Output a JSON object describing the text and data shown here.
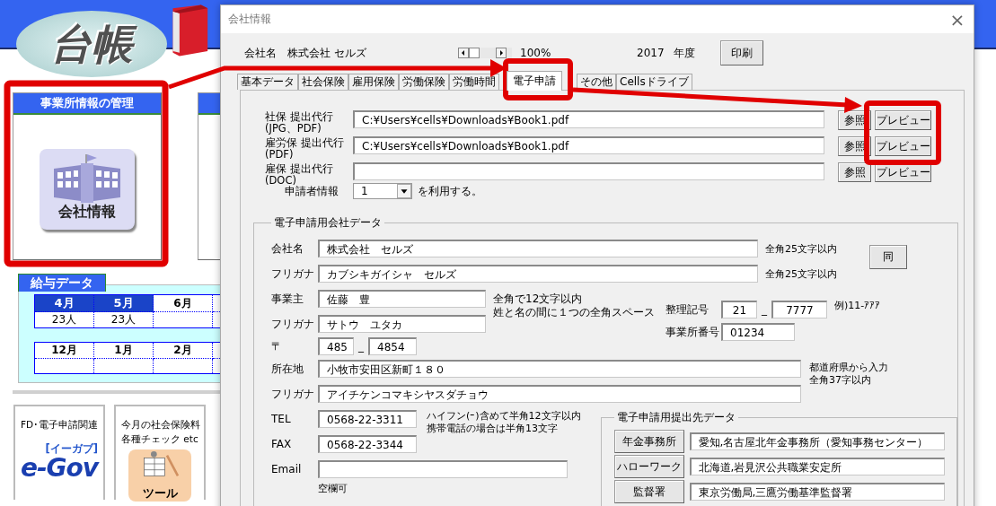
{
  "app": {
    "logo": "台帳",
    "panel": {
      "title": "事業所情報の管理",
      "button": "会社情報"
    },
    "payroll": {
      "title": "給与データ",
      "tables": [
        {
          "months": [
            {
              "label": "4月",
              "highlighted": true,
              "count": "23人"
            },
            {
              "label": "5月",
              "highlighted": true,
              "count": "23人"
            },
            {
              "label": "6月",
              "highlighted": false
            }
          ]
        },
        {
          "months": [
            {
              "label": "12月",
              "highlighted": false
            },
            {
              "label": "1月",
              "highlighted": false
            },
            {
              "label": "2月",
              "highlighted": false
            }
          ]
        }
      ]
    },
    "shortcuts": [
      {
        "kind": "egov",
        "lines": [
          "FD･電子申請関連"
        ],
        "logo": "e-Gov",
        "logo_caption": "[イーガブ]"
      },
      {
        "kind": "tool",
        "lines": [
          "今月の社会保険料",
          "各種チェック etc"
        ],
        "icon_label": "ツール"
      }
    ]
  },
  "dialog": {
    "title": "会社情報",
    "close": "×",
    "company_label": "会社名",
    "company_name": "株式会社 セルズ",
    "zoom": "100%",
    "year": "2017",
    "year_unit": "年度",
    "print_button": "印刷",
    "tabs": [
      {
        "label": "基本データ",
        "selected": false
      },
      {
        "label": "社会保険",
        "selected": false
      },
      {
        "label": "雇用保険",
        "selected": false
      },
      {
        "label": "労働保険",
        "selected": false
      },
      {
        "label": "労働時間",
        "selected": false
      },
      {
        "label": "電子申請",
        "selected": true
      },
      {
        "label": "その他",
        "selected": false
      },
      {
        "label": "Cellsドライブ",
        "selected": false
      }
    ],
    "file_rows": [
      {
        "label": [
          "社保 提出代行",
          "(JPG、PDF)"
        ],
        "value": "C:¥Users¥cells¥Downloads¥Book1.pdf",
        "browse": "参照",
        "preview": "プレビュー"
      },
      {
        "label": [
          "雇労保 提出代行",
          "(PDF)"
        ],
        "value": "C:¥Users¥cells¥Downloads¥Book1.pdf",
        "browse": "参照",
        "preview": "プレビュー"
      },
      {
        "label": [
          "雇保 提出代行",
          "(DOC)"
        ],
        "browse": "参照",
        "preview": "プレビュー"
      }
    ],
    "applicant": {
      "label": "申請者情報",
      "value": "1",
      "suffix": "を利用する。"
    },
    "company_data": {
      "title": "電子申請用会社データ",
      "same_button": "同",
      "name": {
        "label": "会社名",
        "value": "株式会社　セルズ",
        "hint": "全角25文字以内"
      },
      "name_kana": {
        "label": "フリガナ",
        "value": "カブシキガイシャ　セルズ",
        "hint": "全角25文字以内"
      },
      "owner": {
        "label": "事業主",
        "value": "佐藤　豊"
      },
      "owner_kana": {
        "label": "フリガナ",
        "value": "サトウ　ユタカ"
      },
      "owner_hint": [
        "全角で12文字以内",
        "姓と名の間に１つの全角スペース"
      ],
      "postal": {
        "label": "〒",
        "first": "485",
        "separator": "_",
        "second": "4854"
      },
      "reference": {
        "label": "整理記号",
        "first": "21",
        "separator": "_",
        "second": "7777",
        "example": "例)11-ｱｱｱ"
      },
      "office_number": {
        "label": "事業所番号",
        "value": "01234"
      },
      "address": {
        "label": "所在地",
        "value": "小牧市安田区新町１８０"
      },
      "address_kana": {
        "label": "フリガナ",
        "value": "アイチケンコマキシヤスダチョウ"
      },
      "address_hint": [
        "都道府県から入力",
        "全角37字以内"
      ],
      "tel": {
        "label": "TEL",
        "value": "0568-22-3311"
      },
      "tel_hint": [
        "ハイフン(ｰ)含めて半角12文字以内",
        "携帯電話の場合は半角13文字"
      ],
      "fax": {
        "label": "FAX",
        "value": "0568-22-3344"
      },
      "email": {
        "label": "Email",
        "hint": "空欄可"
      }
    },
    "submission": {
      "title": "電子申請用提出先データ",
      "rows": [
        {
          "button": "年金事務所",
          "value": "愛知,名古屋北年金事務所（愛知事務センター）"
        },
        {
          "button": "ハローワーク",
          "value": "北海道,岩見沢公共職業安定所"
        },
        {
          "button": "監督署",
          "value": "東京労働局,三鷹労働基準監督署"
        }
      ]
    }
  }
}
